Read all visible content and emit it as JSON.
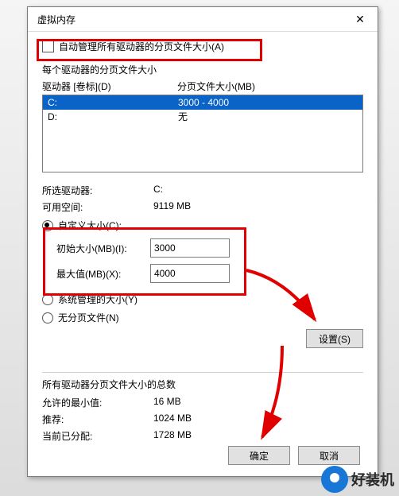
{
  "title": "虚拟内存",
  "auto_manage": "自动管理所有驱动器的分页文件大小(A)",
  "section1": "每个驱动器的分页文件大小",
  "col_drive": "驱动器 [卷标](D)",
  "col_size": "分页文件大小(MB)",
  "drives": [
    {
      "name": "C:",
      "size": "3000 - 4000"
    },
    {
      "name": "D:",
      "size": "无"
    }
  ],
  "selected_drive_label": "所选驱动器:",
  "selected_drive_value": "C:",
  "free_space_label": "可用空间:",
  "free_space_value": "9119 MB",
  "custom_size": "自定义大小(C):",
  "initial_label": "初始大小(MB)(I):",
  "initial_value": "3000",
  "max_label": "最大值(MB)(X):",
  "max_value": "4000",
  "system_managed": "系统管理的大小(Y)",
  "no_paging": "无分页文件(N)",
  "set_btn": "设置(S)",
  "totals_title": "所有驱动器分页文件大小的总数",
  "min_label": "允许的最小值:",
  "min_value": "16 MB",
  "rec_label": "推荐:",
  "rec_value": "1024 MB",
  "cur_label": "当前已分配:",
  "cur_value": "1728 MB",
  "ok": "确定",
  "cancel": "取消",
  "watermark": "好装机"
}
